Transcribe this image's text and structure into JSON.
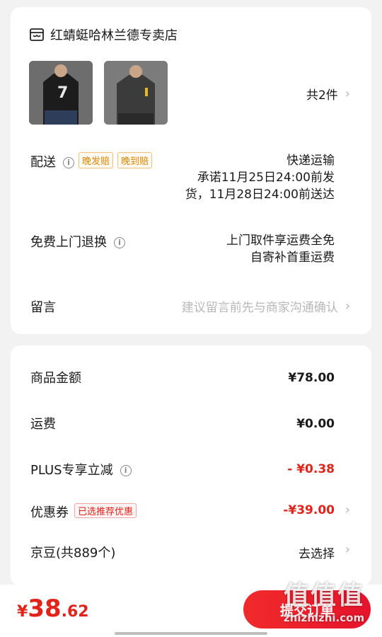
{
  "shop": {
    "name": "红蜻蜓哈林兰德专卖店",
    "icon": "shop-icon"
  },
  "products": {
    "thumbs": [
      {
        "name": "product-thumb-black-sweatshirt",
        "color": "#1c1c1c"
      },
      {
        "name": "product-thumb-grey-sweatshirt",
        "color": "#3b3b3b"
      }
    ],
    "count_label": "共2件"
  },
  "delivery": {
    "label": "配送",
    "tag1": "晚发赔",
    "tag2": "晚到赔",
    "method": "快递运输",
    "promise_line1": "承诺11月25日24:00前发",
    "promise_line2": "货，11月28日24:00前送达"
  },
  "returns": {
    "label": "免费上门退换",
    "line1": "上门取件享运费全免",
    "line2": "自寄补首重运费"
  },
  "note": {
    "label": "留言",
    "placeholder": "建议留言前先与商家沟通确认"
  },
  "price": {
    "goods_label": "商品金额",
    "goods_value": "¥78.00",
    "shipping_label": "运费",
    "shipping_value": "¥0.00",
    "plus_label": "PLUS专享立减",
    "plus_value": "- ¥0.38",
    "coupon_label": "优惠券",
    "coupon_tag": "已选推荐优惠",
    "coupon_value": "-¥39.00",
    "jingdou_label": "京豆(共889个)",
    "jingdou_action": "去选择"
  },
  "bottom": {
    "currency": "¥",
    "total_int": "38",
    "total_dec": ".62",
    "submit_label": "提交订单"
  },
  "watermark": {
    "big": "值值值",
    "small": "zhizhizhi.com"
  },
  "colors": {
    "accent": "#e2231a",
    "tag_orange": "#e08600"
  }
}
